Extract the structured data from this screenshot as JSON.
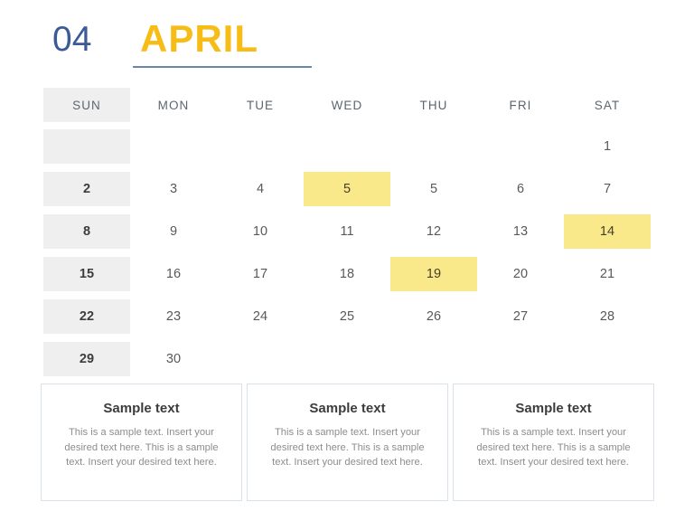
{
  "header": {
    "month_number": "04",
    "month_name": "APRIL",
    "number_color": "#3c5a96",
    "name_color": "#f7bd16",
    "underline_color": "#6b87a8"
  },
  "calendar": {
    "day_headers": [
      "SUN",
      "MON",
      "TUE",
      "WED",
      "THU",
      "FRI",
      "SAT"
    ],
    "sunday_column_bg": "#efefef",
    "highlight_color": "#fae98a",
    "weeks": [
      [
        {
          "label": "",
          "highlight": false,
          "sunday": true
        },
        {
          "label": "",
          "highlight": false,
          "sunday": false
        },
        {
          "label": "",
          "highlight": false,
          "sunday": false
        },
        {
          "label": "",
          "highlight": false,
          "sunday": false
        },
        {
          "label": "",
          "highlight": false,
          "sunday": false
        },
        {
          "label": "",
          "highlight": false,
          "sunday": false
        },
        {
          "label": "1",
          "highlight": false,
          "sunday": false
        }
      ],
      [
        {
          "label": "2",
          "highlight": false,
          "sunday": true
        },
        {
          "label": "3",
          "highlight": false,
          "sunday": false
        },
        {
          "label": "4",
          "highlight": false,
          "sunday": false
        },
        {
          "label": "5",
          "highlight": true,
          "sunday": false
        },
        {
          "label": "5",
          "highlight": false,
          "sunday": false
        },
        {
          "label": "6",
          "highlight": false,
          "sunday": false
        },
        {
          "label": "7",
          "highlight": false,
          "sunday": false
        }
      ],
      [
        {
          "label": "8",
          "highlight": false,
          "sunday": true
        },
        {
          "label": "9",
          "highlight": false,
          "sunday": false
        },
        {
          "label": "10",
          "highlight": false,
          "sunday": false
        },
        {
          "label": "11",
          "highlight": false,
          "sunday": false
        },
        {
          "label": "12",
          "highlight": false,
          "sunday": false
        },
        {
          "label": "13",
          "highlight": false,
          "sunday": false
        },
        {
          "label": "14",
          "highlight": true,
          "sunday": false
        }
      ],
      [
        {
          "label": "15",
          "highlight": false,
          "sunday": true
        },
        {
          "label": "16",
          "highlight": false,
          "sunday": false
        },
        {
          "label": "17",
          "highlight": false,
          "sunday": false
        },
        {
          "label": "18",
          "highlight": false,
          "sunday": false
        },
        {
          "label": "19",
          "highlight": true,
          "sunday": false
        },
        {
          "label": "20",
          "highlight": false,
          "sunday": false
        },
        {
          "label": "21",
          "highlight": false,
          "sunday": false
        }
      ],
      [
        {
          "label": "22",
          "highlight": false,
          "sunday": true
        },
        {
          "label": "23",
          "highlight": false,
          "sunday": false
        },
        {
          "label": "24",
          "highlight": false,
          "sunday": false
        },
        {
          "label": "25",
          "highlight": false,
          "sunday": false
        },
        {
          "label": "26",
          "highlight": false,
          "sunday": false
        },
        {
          "label": "27",
          "highlight": false,
          "sunday": false
        },
        {
          "label": "28",
          "highlight": false,
          "sunday": false
        }
      ],
      [
        {
          "label": "29",
          "highlight": false,
          "sunday": true
        },
        {
          "label": "30",
          "highlight": false,
          "sunday": false
        },
        {
          "label": "",
          "highlight": false,
          "sunday": false
        },
        {
          "label": "",
          "highlight": false,
          "sunday": false
        },
        {
          "label": "",
          "highlight": false,
          "sunday": false
        },
        {
          "label": "",
          "highlight": false,
          "sunday": false
        },
        {
          "label": "",
          "highlight": false,
          "sunday": false
        }
      ]
    ]
  },
  "notes": {
    "border_color": "#d9e2ea",
    "cards": [
      {
        "title": "Sample text",
        "body": "This is a sample text. Insert your desired text here. This is a sample text. Insert your desired text here."
      },
      {
        "title": "Sample text",
        "body": "This is a sample text. Insert your desired text here. This is a sample text. Insert your desired text here."
      },
      {
        "title": "Sample text",
        "body": "This is a sample text. Insert your desired text here. This is a sample text. Insert your desired text here."
      }
    ]
  }
}
